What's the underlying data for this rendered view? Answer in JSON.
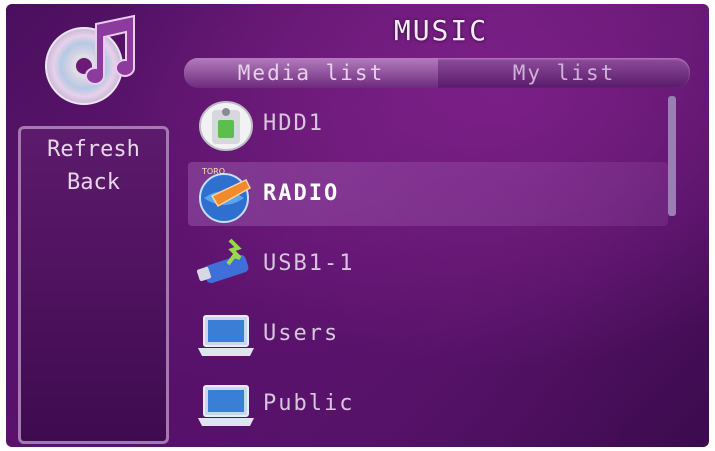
{
  "title": "MUSIC",
  "tabs": [
    {
      "label": "Media list",
      "active": true
    },
    {
      "label": "My list",
      "active": false
    }
  ],
  "side_menu": [
    "Refresh",
    "Back"
  ],
  "list_items": [
    {
      "label": "HDD1",
      "icon": "hdd-icon"
    },
    {
      "label": "RADIO",
      "icon": "radio-globe-icon",
      "selected": true
    },
    {
      "label": "USB1-1",
      "icon": "usb-drive-icon"
    },
    {
      "label": "Users",
      "icon": "laptop-icon"
    },
    {
      "label": "Public",
      "icon": "laptop-icon"
    }
  ],
  "colors": {
    "background": "#5a1468",
    "tab_bar": "#8e4c9c",
    "panel_border": "#a27aab",
    "text": "#d8c6dd"
  }
}
